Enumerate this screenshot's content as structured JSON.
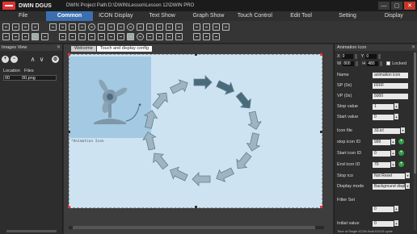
{
  "window": {
    "app_name": "DWIN DGUS",
    "project_path": "DWIN Project Path:D:\\DWIN\\Lesson\\Lesson 12\\DWIN PRO",
    "minimize": "—",
    "maximize": "▢",
    "close": "✕"
  },
  "menu": {
    "items": [
      "File",
      "Common",
      "ICON Display",
      "Text Show",
      "Graph Show",
      "Touch Control",
      "Edit Tool",
      "Setting",
      "Display"
    ],
    "active": "Common"
  },
  "left_panel": {
    "title": "Images View",
    "close": "✕",
    "nav_add": "+",
    "nav_remove": "−",
    "nav_up": "∧",
    "nav_down": "∨",
    "nav_settings": "⚙",
    "col_location": "Location",
    "col_files": "Files",
    "row_location": "00",
    "row_file": "00.png"
  },
  "canvas": {
    "tabs": [
      "Welcome",
      "Touch and display config"
    ],
    "active_tab": "Touch and display config",
    "widget_label": "*Animation Icon"
  },
  "right_panel": {
    "title": "Animation Icon",
    "close": "✕",
    "x_label": "X",
    "x_value": "0",
    "y_label": "Y",
    "y_value": "0",
    "w_label": "W",
    "w_value": "800",
    "h_label": "H",
    "h_value": "480",
    "locked_label": "Locked",
    "props": {
      "name_label": "Name",
      "name_value": "animation icon",
      "sp_label": "SP (0x)",
      "sp_value": "FFFF",
      "vp_label": "VP (0x)",
      "vp_value": "5000",
      "stop_label": "Stop value",
      "stop_value": "1",
      "start_label": "Start value",
      "start_value": "0",
      "icon_file_label": "Icon file",
      "icon_file_value": "33.icl",
      "stop_icon_label": "stop icon ID",
      "stop_icon_value": "999",
      "start_icon_label": "Start icon ID",
      "start_icon_value": "0",
      "end_icon_label": "End icon ID",
      "end_icon_value": "70",
      "stop_ico_label": "Stop ico",
      "stop_ico_value": "Not Reset",
      "display_mode_label": "Display mode",
      "display_mode_value": "Background displ",
      "filter_label": "Filter Set",
      "filter_value": "0",
      "initial_label": "Initial value",
      "initial_value": "0"
    },
    "green_plus": "+",
    "footer": "Time of Single ICON Hold DGUS cycle"
  },
  "colors": {
    "accent": "#3b6fb0",
    "page_bg": "#cde3f1",
    "bg_image": "#a4c9e2",
    "ring": "#5f7f8f",
    "green": "#2ea043"
  }
}
